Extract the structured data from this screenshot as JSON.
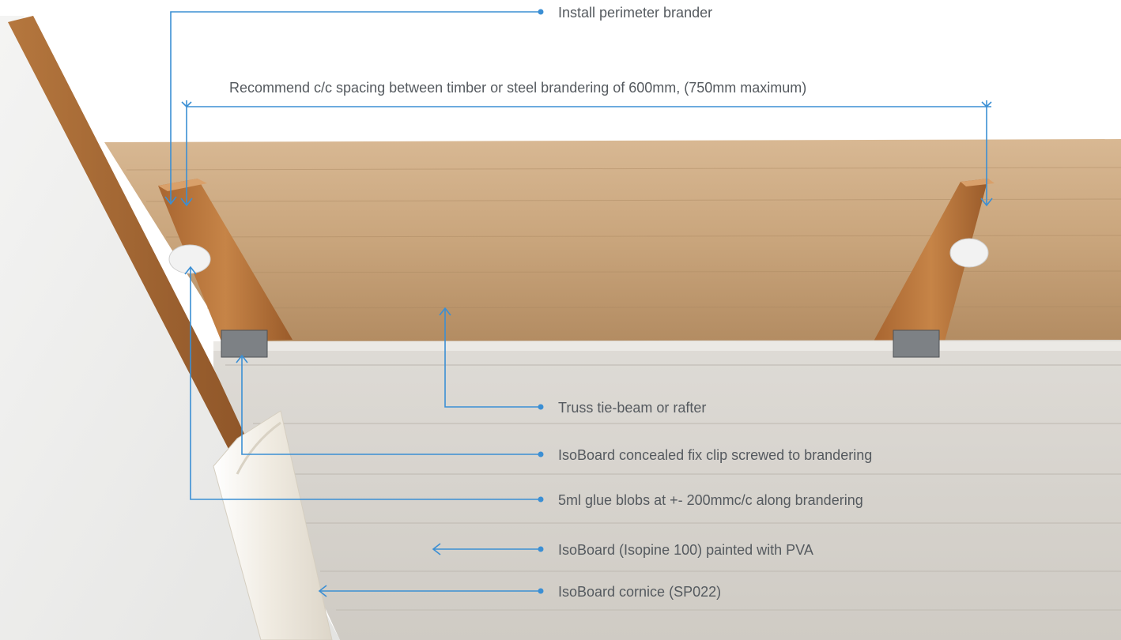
{
  "annotations": {
    "perimeter_brander": "Install perimeter brander",
    "spacing": "Recommend c/c spacing between timber or steel brandering of 600mm, (750mm maximum)",
    "truss": "Truss tie-beam or rafter",
    "clip": "IsoBoard concealed fix clip screwed to brandering",
    "glue": "5ml glue blobs at +- 200mmc/c along brandering",
    "board": "IsoBoard (Isopine 100) painted with PVA",
    "cornice": "IsoBoard cornice (SP022)"
  },
  "colors": {
    "annotation_line": "#3b8fd4",
    "label_text": "#555a5f",
    "wall": "#eeeeec",
    "timber": "#c9a57c",
    "brander": "#b8733a",
    "isoboard": "#d9d6d1",
    "cornice": "#f4f1ea"
  }
}
